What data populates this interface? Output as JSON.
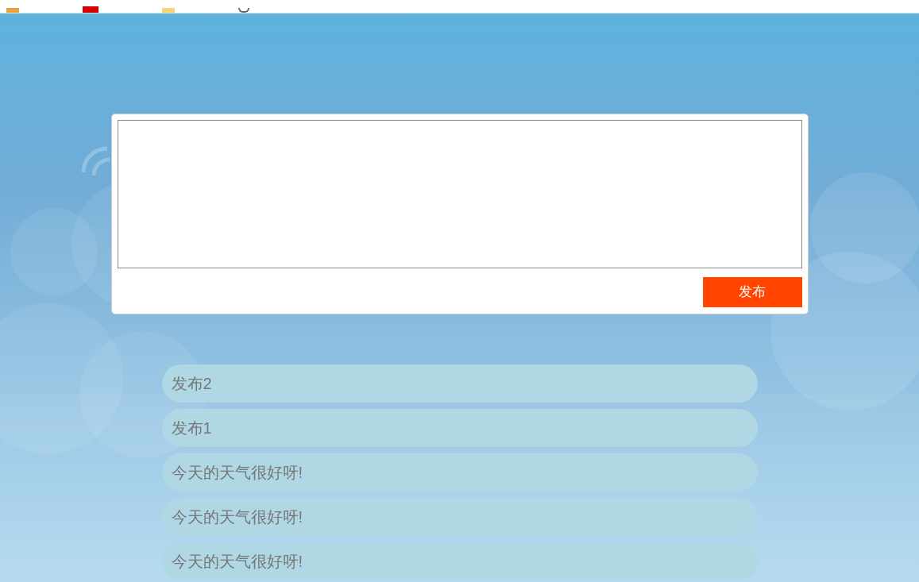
{
  "composer": {
    "button": "发布"
  },
  "posts": [
    {
      "text": "发布2"
    },
    {
      "text": "发布1"
    },
    {
      "text": "今天的天气很好呀!"
    },
    {
      "text": "今天的天气很好呀!"
    },
    {
      "text": "今天的天气很好呀!"
    }
  ]
}
